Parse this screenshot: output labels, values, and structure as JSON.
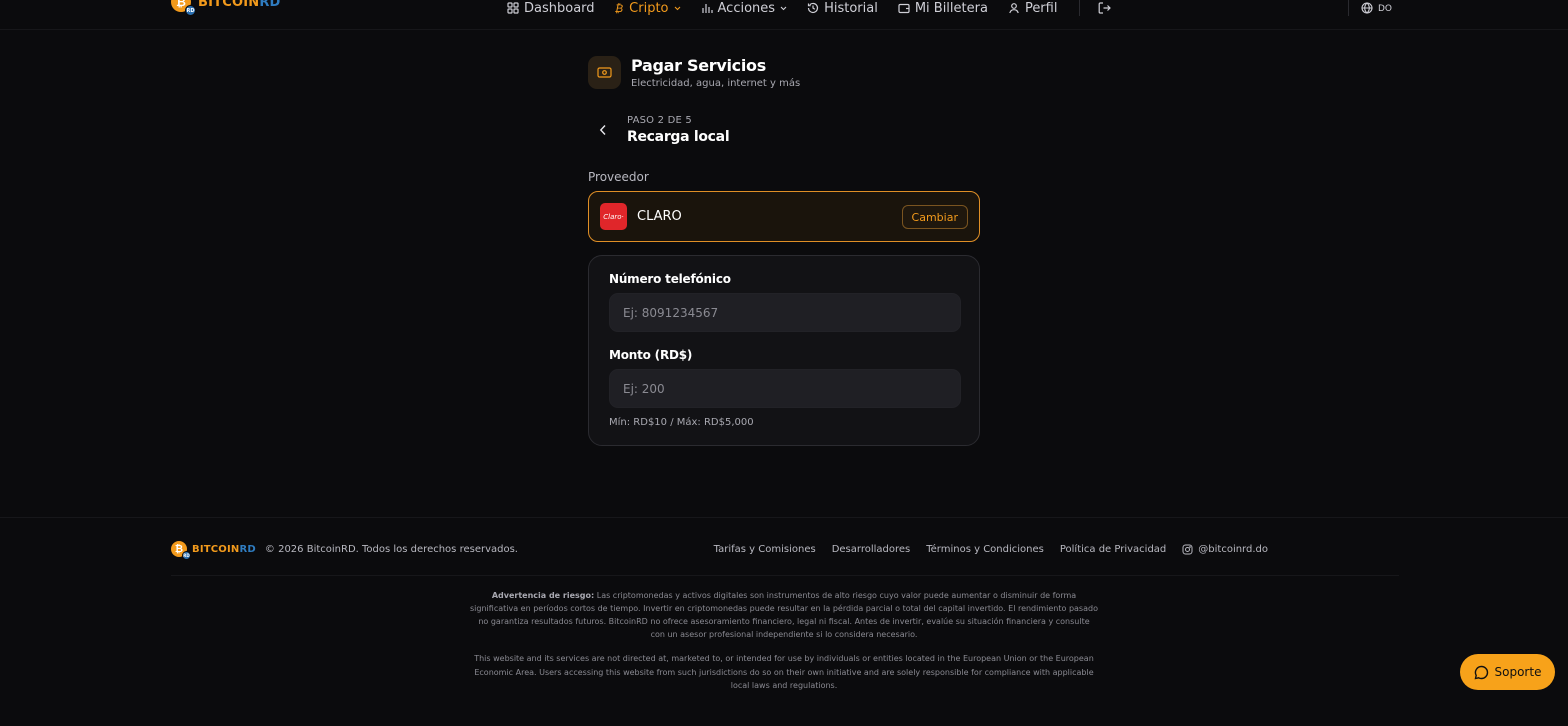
{
  "brand": {
    "part1": "BITCOIN",
    "part2": "RD",
    "coin_glyph": "₿",
    "badge": "RD"
  },
  "nav": {
    "items": [
      {
        "label": "Dashboard",
        "icon": "grid-icon"
      },
      {
        "label": "Cripto",
        "icon": "bitcoin-icon",
        "active": true,
        "dropdown": true
      },
      {
        "label": "Acciones",
        "icon": "bar-chart-icon",
        "dropdown": true
      },
      {
        "label": "Historial",
        "icon": "history-icon"
      },
      {
        "label": "Mi Billetera",
        "icon": "wallet-icon"
      },
      {
        "label": "Perfil",
        "icon": "user-icon"
      }
    ],
    "logout_icon": "logout-icon",
    "language": "DO"
  },
  "service": {
    "title": "Pagar Servicios",
    "subtitle": "Electricidad, agua, internet y más",
    "icon": "banknote-icon"
  },
  "step": {
    "label": "PASO 2 DE 5",
    "title": "Recarga local"
  },
  "provider": {
    "label": "Proveedor",
    "name": "CLARO",
    "logo_text": "Claro·",
    "change_label": "Cambiar"
  },
  "form": {
    "phone_label": "Número telefónico",
    "phone_placeholder": "Ej: 8091234567",
    "amount_label": "Monto (RD$)",
    "amount_placeholder": "Ej: 200",
    "hint": "Mín: RD$10 / Máx: RD$5,000"
  },
  "footer": {
    "copyright": "© 2026 BitcoinRD. Todos los derechos reservados.",
    "links": [
      "Tarifas y Comisiones",
      "Desarrolladores",
      "Términos y Condiciones",
      "Política de Privacidad"
    ],
    "instagram": "@bitcoinrd.do",
    "disclaimer_title": "Advertencia de riesgo:",
    "disclaimer_text": "Las criptomonedas y activos digitales son instrumentos de alto riesgo cuyo valor puede aumentar o disminuir de forma significativa en períodos cortos de tiempo. Invertir en criptomonedas puede resultar en la pérdida parcial o total del capital invertido. El rendimiento pasado no garantiza resultados futuros. BitcoinRD no ofrece asesoramiento financiero, legal ni fiscal. Antes de invertir, evalúe su situación financiera y consulte con un asesor profesional independiente si lo considera necesario.",
    "eu_notice": "This website and its services are not directed at, marketed to, or intended for use by individuals or entities located in the European Union or the European Economic Area. Users accessing this website from such jurisdictions do so on their own initiative and are solely responsible for compliance with applicable local laws and regulations."
  },
  "support": {
    "label": "Soporte",
    "icon": "chat-icon"
  },
  "colors": {
    "accent": "#f29a1c",
    "background": "#0b0b0d",
    "card": "#121215",
    "claro_red": "#e0262a"
  }
}
